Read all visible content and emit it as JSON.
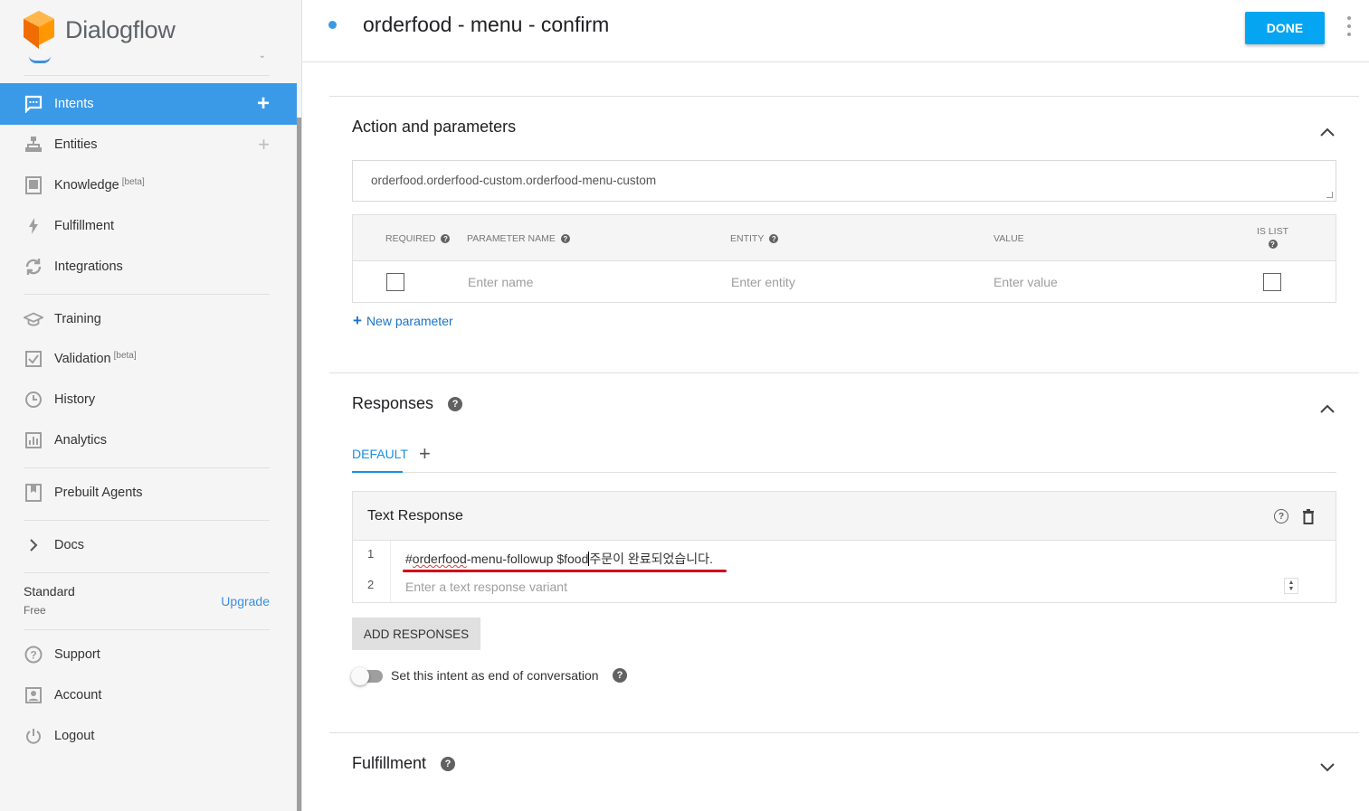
{
  "app": {
    "name": "Dialogflow"
  },
  "sidebar": {
    "items": [
      {
        "label": "Intents",
        "icon": "chat-icon",
        "active": true
      },
      {
        "label": "Entities",
        "icon": "hierarchy-icon"
      },
      {
        "label": "Knowledge",
        "icon": "book-icon",
        "badge": "[beta]"
      },
      {
        "label": "Fulfillment",
        "icon": "bolt-icon"
      },
      {
        "label": "Integrations",
        "icon": "sync-icon"
      },
      {
        "label": "Training",
        "icon": "graduation-cap-icon"
      },
      {
        "label": "Validation",
        "icon": "checkbox-icon",
        "badge": "[beta]"
      },
      {
        "label": "History",
        "icon": "clock-icon"
      },
      {
        "label": "Analytics",
        "icon": "bar-chart-icon"
      },
      {
        "label": "Prebuilt Agents",
        "icon": "bookmark-book-icon"
      },
      {
        "label": "Docs",
        "icon": "chevron-right-icon"
      },
      {
        "label": "Support",
        "icon": "question-circle-icon"
      },
      {
        "label": "Account",
        "icon": "account-box-icon"
      },
      {
        "label": "Logout",
        "icon": "power-icon"
      }
    ],
    "plan": {
      "name": "Standard",
      "tier": "Free",
      "upgrade_label": "Upgrade"
    }
  },
  "header": {
    "intent_name": "orderfood - menu - confirm",
    "done_label": "DONE"
  },
  "action_section": {
    "title": "Action and parameters",
    "action_value": "orderfood.orderfood-custom.orderfood-menu-custom",
    "columns": {
      "required": "REQUIRED",
      "name": "PARAMETER NAME",
      "entity": "ENTITY",
      "value": "VALUE",
      "is_list": "IS LIST"
    },
    "row": {
      "name_placeholder": "Enter name",
      "entity_placeholder": "Enter entity",
      "value_placeholder": "Enter value"
    },
    "new_parameter_label": "New parameter"
  },
  "responses_section": {
    "title": "Responses",
    "tabs": [
      "DEFAULT"
    ],
    "card_title": "Text Response",
    "lines": [
      {
        "num": "1",
        "text_prefix": "#",
        "text_misspelled": "orderfood",
        "text_rest": "-menu-followup $food",
        "text_after_caret": "주문이 완료되었습니다."
      },
      {
        "num": "2",
        "placeholder": "Enter a text response variant"
      }
    ],
    "add_label": "ADD RESPONSES",
    "end_conversation_label": "Set this intent as end of conversation",
    "end_conversation": false
  },
  "fulfillment_section": {
    "title": "Fulfillment"
  },
  "colors": {
    "accent": "#3b9ae8",
    "done": "#06a5f2",
    "highlight": "#d0021b"
  }
}
